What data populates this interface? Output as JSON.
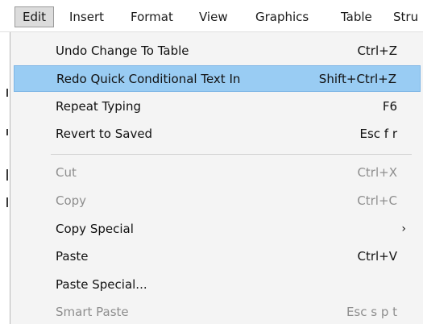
{
  "menubar": {
    "items": [
      {
        "label": "Edit",
        "active": true
      },
      {
        "label": "Insert"
      },
      {
        "label": "Format"
      },
      {
        "label": "View"
      },
      {
        "label": "Graphics"
      },
      {
        "label": "Table"
      },
      {
        "label": "Stru"
      }
    ]
  },
  "menu": {
    "undo": {
      "label": "Undo Change To Table",
      "shortcut": "Ctrl+Z"
    },
    "redo": {
      "label": "Redo Quick Conditional Text In",
      "shortcut": "Shift+Ctrl+Z"
    },
    "repeat": {
      "label": "Repeat Typing",
      "shortcut": "F6"
    },
    "revert": {
      "label": "Revert to Saved",
      "shortcut": "Esc f r"
    },
    "cut": {
      "label": "Cut",
      "shortcut": "Ctrl+X"
    },
    "copy": {
      "label": "Copy",
      "shortcut": "Ctrl+C"
    },
    "copy_special": {
      "label": "Copy Special",
      "submenu_indicator": "›"
    },
    "paste": {
      "label": "Paste",
      "shortcut": "Ctrl+V"
    },
    "paste_special": {
      "label": "Paste Special..."
    },
    "smart_paste": {
      "label": "Smart Paste",
      "shortcut": "Esc s p t"
    }
  },
  "colors": {
    "highlight": "#99ccf3",
    "menu_bg": "#f4f4f4",
    "disabled_text": "#8e8e8e"
  }
}
